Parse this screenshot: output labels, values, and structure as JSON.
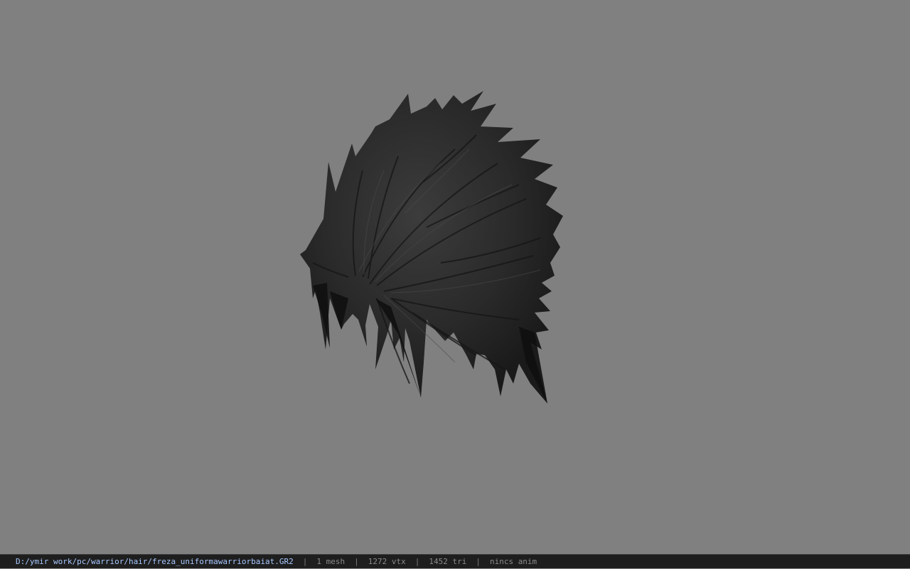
{
  "viewport": {
    "background_color": "#808080",
    "model": {
      "icon": "hair-mesh",
      "color": "#2b2b2b"
    }
  },
  "statusbar": {
    "file_path": "D:/ymir work/pc/warrior/hair/freza_uniformawarriorbaiat.GR2",
    "separator": "|",
    "mesh_count": "1 mesh",
    "vertex_count": "1272 vtx",
    "triangle_count": "1452 tri",
    "anim_status": "nincs anim",
    "path_color": "#a8c8ff",
    "text_color": "#8a8a8a"
  }
}
